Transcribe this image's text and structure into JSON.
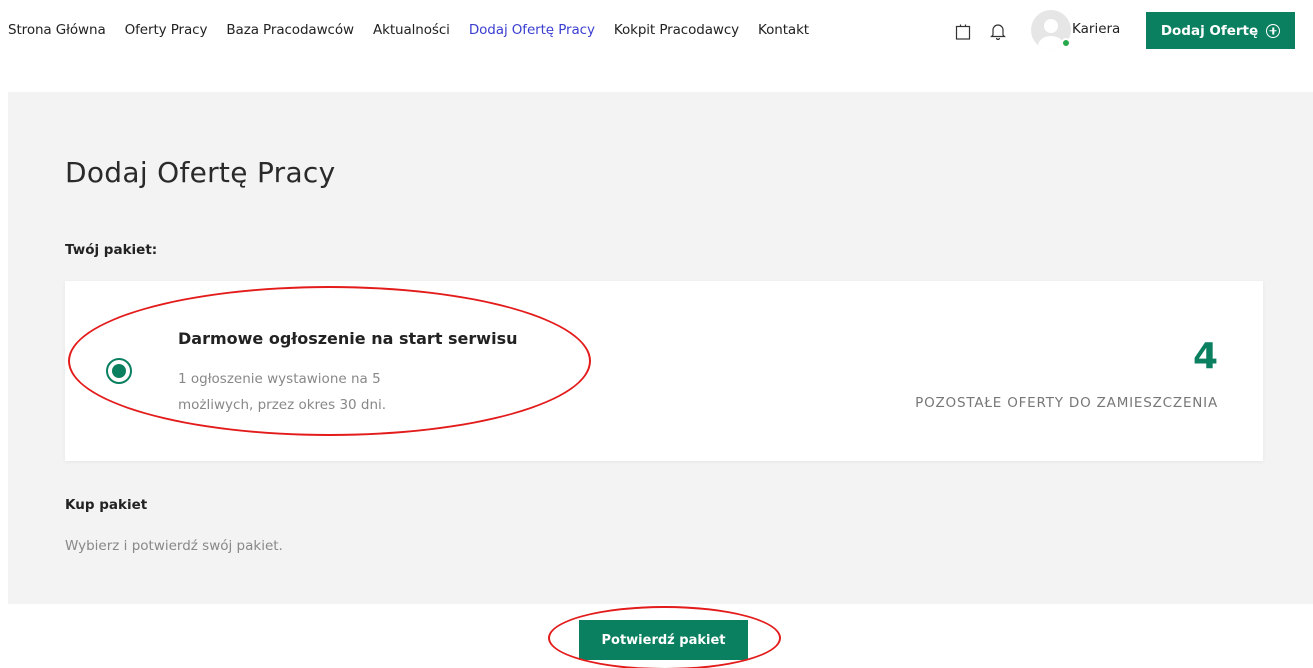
{
  "nav": {
    "items": [
      {
        "label": "Strona Główna",
        "active": false
      },
      {
        "label": "Oferty Pracy",
        "active": false
      },
      {
        "label": "Baza Pracodawców",
        "active": false
      },
      {
        "label": "Aktualności",
        "active": false
      },
      {
        "label": "Dodaj Ofertę Pracy",
        "active": true
      },
      {
        "label": "Kokpit Pracodawcy",
        "active": false
      },
      {
        "label": "Kontakt",
        "active": false
      }
    ]
  },
  "header": {
    "cart_icon": "shopping-bag-icon",
    "notification_icon": "bell-icon",
    "user_name": "Kariera",
    "user_status_color": "#27a84a",
    "add_offer_label": "Dodaj Ofertę",
    "add_offer_icon": "plus-circle-icon"
  },
  "main": {
    "title": "Dodaj Ofertę Pracy",
    "your_package_label": "Twój pakiet:",
    "package": {
      "name": "Darmowe ogłoszenie na start serwisu",
      "description": "1 ogłoszenie wystawione na 5 możliwych, przez okres 30 dni.",
      "selected": true,
      "remaining_count": "4",
      "remaining_label": "POZOSTAŁE OFERTY DO ZAMIESZCZENIA"
    },
    "buy_package_label": "Kup pakiet",
    "buy_package_hint": "Wybierz i potwierdź swój pakiet."
  },
  "confirm_button_label": "Potwierdź pakiet",
  "colors": {
    "accent": "#0b8060",
    "active_nav": "#3b3fd0",
    "annotation": "#e31b1b",
    "panel_bg": "#f3f3f3"
  }
}
